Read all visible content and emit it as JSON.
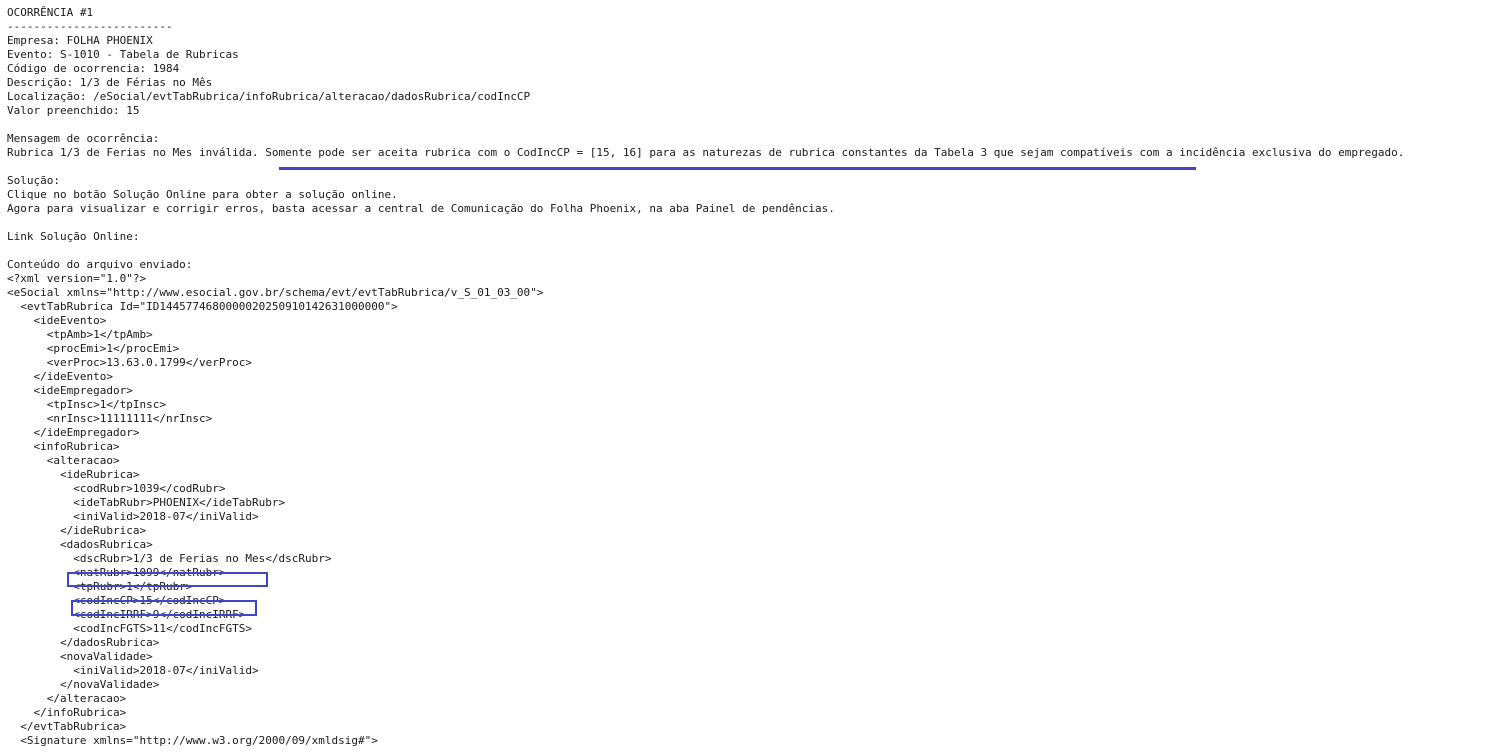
{
  "document": {
    "lines": [
      "-------------------------",
      "OCORRÊNCIA #1",
      "-------------------------",
      "Empresa: FOLHA PHOENIX",
      "Evento: S-1010 - Tabela de Rubricas",
      "Código de ocorrencia: 1984",
      "Descrição: 1/3 de Férias no Mês",
      "Localização: /eSocial/evtTabRubrica/infoRubrica/alteracao/dadosRubrica/codIncCP",
      "Valor preenchido: 15",
      "",
      "Mensagem de ocorrência:",
      "Rubrica 1/3 de Ferias no Mes inválida. Somente pode ser aceita rubrica com o CodIncCP = [15, 16] para as naturezas de rubrica constantes da Tabela 3 que sejam compatíveis com a incidência exclusiva do empregado.",
      "",
      "Solução:",
      "Clique no botão Solução Online para obter a solução online.",
      "Agora para visualizar e corrigir erros, basta acessar a central de Comunicação do Folha Phoenix, na aba Painel de pendências.",
      "",
      "Link Solução Online:",
      "",
      "Conteúdo do arquivo enviado:",
      "<?xml version=\"1.0\"?>",
      "<eSocial xmlns=\"http://www.esocial.gov.br/schema/evt/evtTabRubrica/v_S_01_03_00\">",
      "  <evtTabRubrica Id=\"ID1445774680000020250910142631000000\">",
      "    <ideEvento>",
      "      <tpAmb>1</tpAmb>",
      "      <procEmi>1</procEmi>",
      "      <verProc>13.63.0.1799</verProc>",
      "    </ideEvento>",
      "    <ideEmpregador>",
      "      <tpInsc>1</tpInsc>",
      "      <nrInsc>11111111</nrInsc>",
      "    </ideEmpregador>",
      "    <infoRubrica>",
      "      <alteracao>",
      "        <ideRubrica>",
      "          <codRubr>1039</codRubr>",
      "          <ideTabRubr>PHOENIX</ideTabRubr>",
      "          <iniValid>2018-07</iniValid>",
      "        </ideRubrica>",
      "        <dadosRubrica>",
      "          <dscRubr>1/3 de Ferias no Mes</dscRubr>",
      "          <natRubr>1099</natRubr>",
      "          <tpRubr>1</tpRubr>",
      "          <codIncCP>15</codIncCP>",
      "          <codIncIRRF>9</codIncIRRF>",
      "          <codIncFGTS>11</codIncFGTS>",
      "        </dadosRubrica>",
      "        <novaValidade>",
      "          <iniValid>2018-07</iniValid>",
      "        </novaValidade>",
      "      </alteracao>",
      "    </infoRubrica>",
      "  </evtTabRubrica>",
      "  <Signature xmlns=\"http://www.w3.org/2000/09/xmldsig#\">"
    ]
  },
  "annotations": {
    "highlight_color": "#3f46c7",
    "underlined_text": "Somente pode ser aceita rubrica com o CodIncCP = [15, 16] para as naturezas de rubrica constantes da Tabela 3 que sejam compatíveis",
    "boxed_lines": [
      "<natRubr>1099</natRubr>",
      "<codIncCP>15</codIncCP>"
    ]
  }
}
